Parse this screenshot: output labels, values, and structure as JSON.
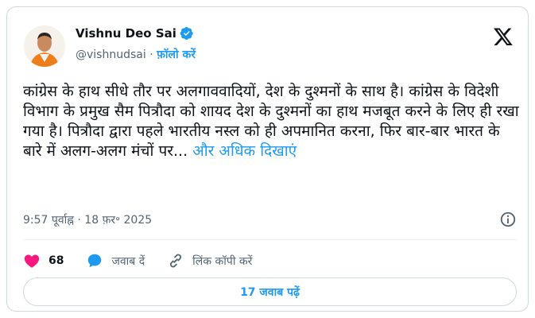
{
  "author": {
    "name": "Vishnu Deo Sai",
    "handle": "@vishnudsai",
    "separator": "·",
    "follow_label": "फ़ॉलो करें"
  },
  "post": {
    "text": "कांग्रेस के हाथ सीधे तौर पर अलगाववादियों, देश के दुश्मनों के साथ है। कांग्रेस के विदेशी विभाग के प्रमुख सैम पित्रौदा को शायद देश के दुश्मनों का हाथ मजबूत करने के लिए ही रखा गया है। पित्रौदा द्वारा पहले भारतीय नस्ल को ही अपमानित करना, फिर बार-बार भारत के बारे में अलग-अलग मंचों पर...",
    "show_more_label": "और अधिक दिखाएं",
    "timestamp": "9:57 पूर्वाह्न · 18 फ़र॰ 2025"
  },
  "actions": {
    "like_count": "68",
    "reply_label": "जवाब दें",
    "copy_link_label": "लिंक कॉपी करें"
  },
  "replies_button_label": "17 जवाब पढ़ें",
  "colors": {
    "accent": "#1d9bf0",
    "like": "#f91880",
    "muted": "#536471",
    "border": "#cfd9de"
  },
  "icons": [
    "verified-badge-icon",
    "x-logo-icon",
    "info-icon",
    "heart-icon",
    "reply-bubble-icon",
    "link-icon"
  ]
}
